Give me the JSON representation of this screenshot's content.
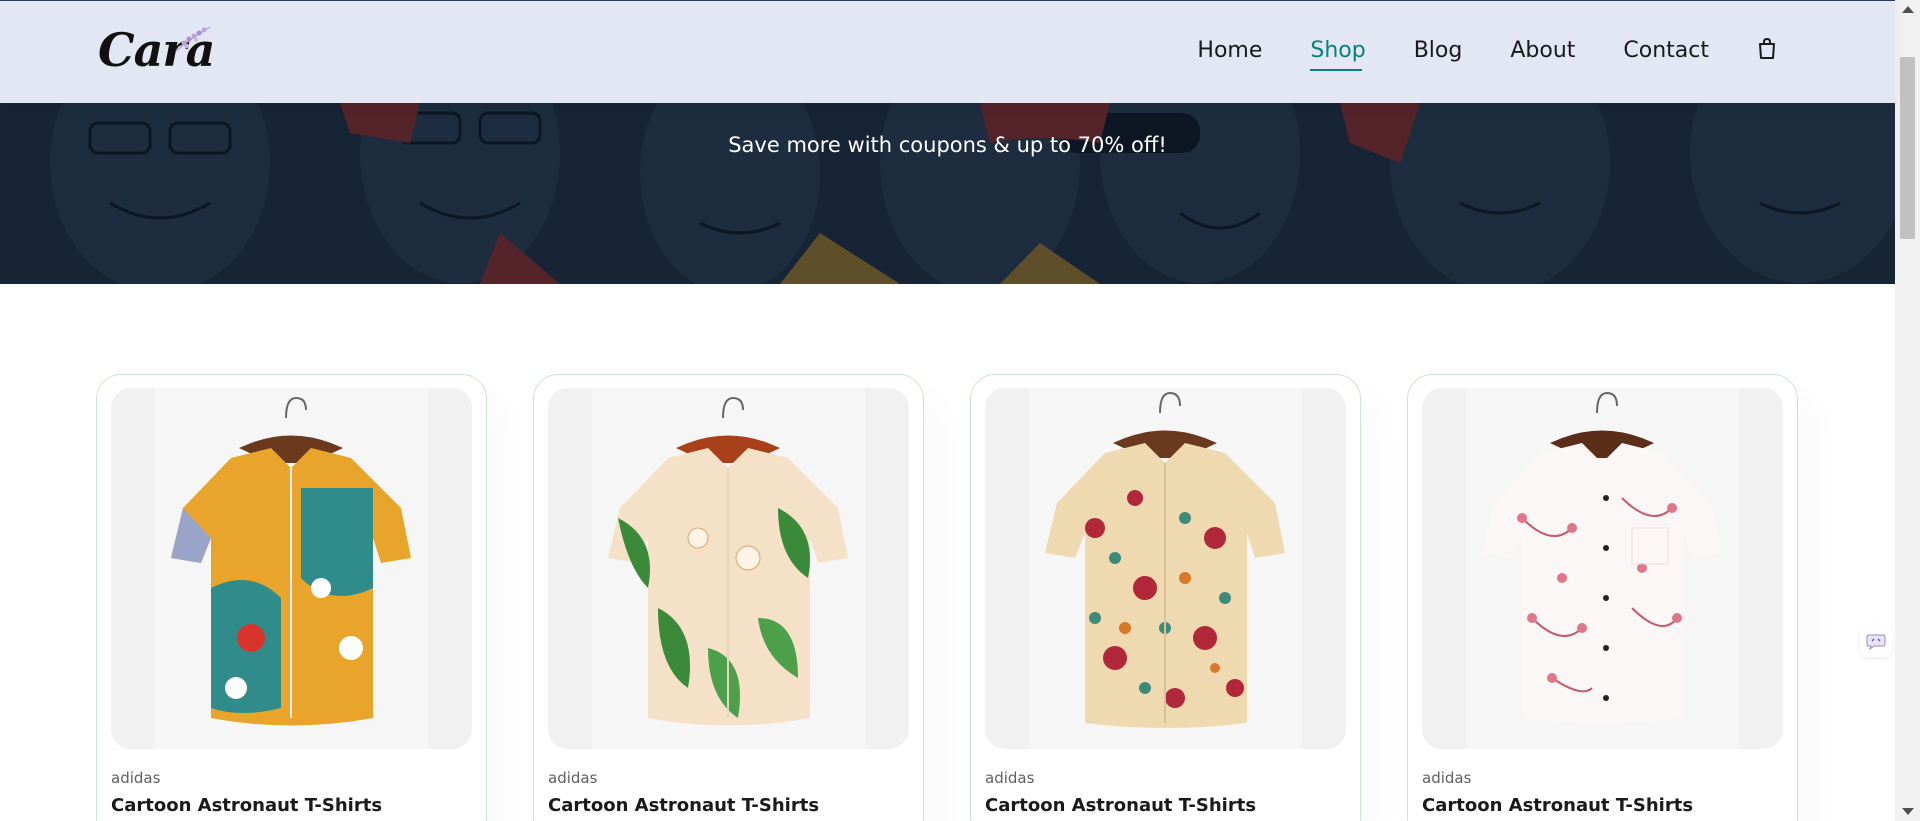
{
  "logo": {
    "text": "Cara"
  },
  "nav": {
    "items": [
      {
        "label": "Home",
        "active": false
      },
      {
        "label": "Shop",
        "active": true
      },
      {
        "label": "Blog",
        "active": false
      },
      {
        "label": "About",
        "active": false
      },
      {
        "label": "Contact",
        "active": false
      }
    ],
    "cart_icon": "shopping-bag-icon"
  },
  "hero": {
    "subtitle": "Save more with coupons & up to 70% off!"
  },
  "products": [
    {
      "brand": "adidas",
      "name": "Cartoon Astronaut T-Shirts",
      "image_icon": "shirt-abstract-print-icon"
    },
    {
      "brand": "adidas",
      "name": "Cartoon Astronaut T-Shirts",
      "image_icon": "shirt-leaf-print-icon"
    },
    {
      "brand": "adidas",
      "name": "Cartoon Astronaut T-Shirts",
      "image_icon": "shirt-floral-print-icon"
    },
    {
      "brand": "adidas",
      "name": "Cartoon Astronaut T-Shirts",
      "image_icon": "shirt-blossom-print-icon"
    }
  ],
  "colors": {
    "accent": "#088178",
    "header_bg": "#e3e6f3",
    "card_border": "#cce7d0"
  }
}
